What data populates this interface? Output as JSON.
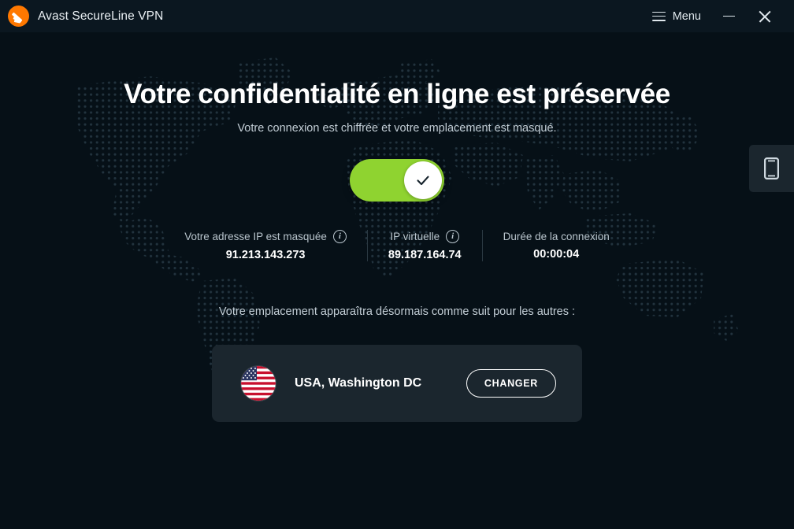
{
  "window": {
    "app_title": "Avast SecureLine VPN",
    "logo_icon": "avast-logo-icon",
    "menu_label": "Menu",
    "menu_icon": "hamburger-icon",
    "minimize_icon": "minimize-icon",
    "close_icon": "close-icon"
  },
  "main": {
    "headline": "Votre confidentialité en ligne est préservée",
    "subtitle": "Votre connexion est chiffrée et votre emplacement est masqué.",
    "toggle": {
      "state": "on",
      "icon": "checkmark-icon"
    },
    "stats": [
      {
        "label": "Votre adresse IP est masquée",
        "value": "91.213.143.273",
        "info_icon": "info-icon",
        "info_glyph": "i"
      },
      {
        "label": "IP virtuelle",
        "value": "89.187.164.74",
        "info_icon": "info-icon",
        "info_glyph": "i"
      },
      {
        "label": "Durée de la connexion",
        "value": "00:00:04"
      }
    ],
    "location_caption": "Votre emplacement apparaîtra désormais comme suit pour les autres :",
    "location": {
      "flag_icon": "usa-flag-icon",
      "name": "USA, Washington DC",
      "change_label": "CHANGER"
    }
  },
  "side_tab": {
    "icon": "mobile-device-icon"
  },
  "colors": {
    "background": "#061017",
    "titlebar": "#0b1720",
    "accent_green": "#8fd330",
    "brand_orange": "#ff7800",
    "card": "#1b262e",
    "map_dot": "#1d2d37",
    "muted_text": "#c3ced6"
  }
}
